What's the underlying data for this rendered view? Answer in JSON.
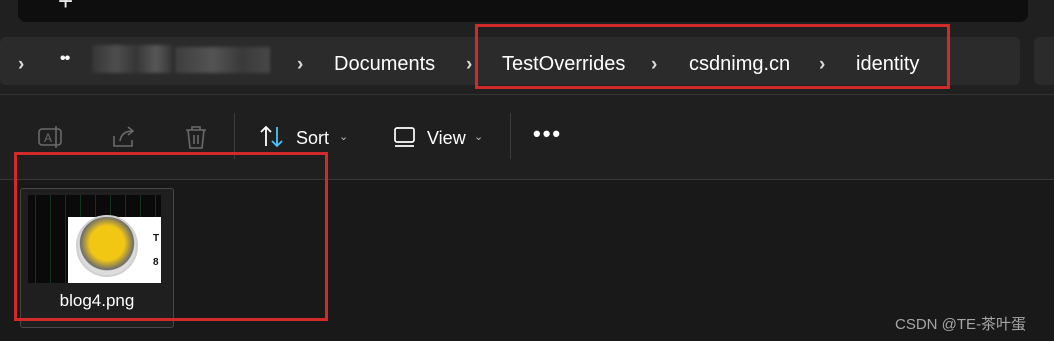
{
  "titlebar": {
    "new_tab_label": "+"
  },
  "breadcrumb": {
    "overflow_label": "••",
    "items": [
      "Documents",
      "TestOverrides",
      "csdnimg.cn",
      "identity"
    ],
    "separator": "›"
  },
  "toolbar": {
    "sort_label": "Sort",
    "view_label": "View",
    "more_label": "•••",
    "caret": "⌄"
  },
  "files": [
    {
      "name": "blog4.png",
      "thumbnail_text": [
        "T",
        "8"
      ]
    }
  ],
  "watermark": "CSDN @TE-茶叶蛋",
  "colors": {
    "highlight": "#d02a2a",
    "background": "#1c1c1c",
    "accent": "#4cc2ff"
  }
}
